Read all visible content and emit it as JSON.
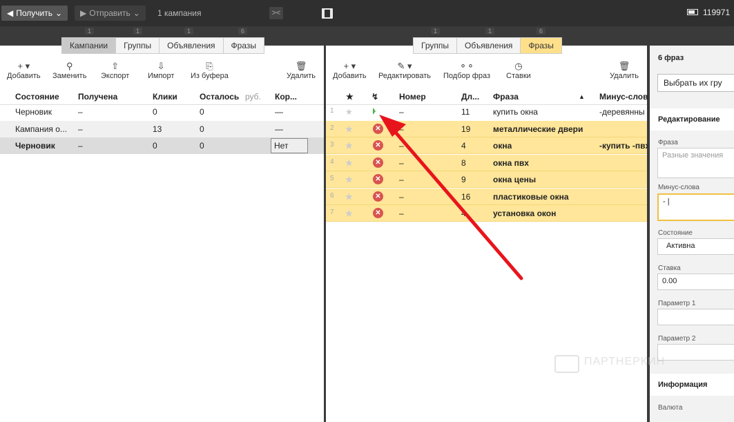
{
  "topbar": {
    "get_label": "Получить",
    "send_label": "Отправить",
    "campaigns_count": "1 кампания",
    "user_id": "119971"
  },
  "badges": [
    "1",
    "1",
    "1",
    "6",
    "1",
    "1",
    "6"
  ],
  "left": {
    "tabs": [
      "Кампании",
      "Группы",
      "Объявления",
      "Фразы"
    ],
    "active_tab": 0,
    "toolbar": [
      "Добавить",
      "Заменить",
      "Экспорт",
      "Импорт",
      "Из буфера",
      "Удалить"
    ],
    "columns": [
      "Состояние",
      "Получена",
      "Клики",
      "Осталось",
      "руб.",
      "Кор..."
    ],
    "rows": [
      {
        "state": "Черновик",
        "received": "–",
        "clicks": "0",
        "left": "0",
        "kor": "—"
      },
      {
        "state": "Кампания о...",
        "received": "–",
        "clicks": "13",
        "left": "0",
        "kor": "—"
      },
      {
        "state": "Черновик",
        "received": "–",
        "clicks": "0",
        "left": "0",
        "kor": "Нет"
      }
    ]
  },
  "mid": {
    "tabs": [
      "Группы",
      "Объявления",
      "Фразы"
    ],
    "active_tab": 2,
    "toolbar": [
      "Добавить",
      "Редактировать",
      "Подбор фраз",
      "Ставки",
      "Удалить"
    ],
    "columns": [
      "★",
      "Номер",
      "Дл...",
      "Фраза",
      "Минус-слов"
    ],
    "rows": [
      {
        "n": "1",
        "num": "–",
        "len": "11",
        "phrase": "купить окна",
        "minus": "-деревянны"
      },
      {
        "n": "2",
        "num": "–",
        "len": "19",
        "phrase": "металлические двери",
        "minus": ""
      },
      {
        "n": "3",
        "num": "–",
        "len": "4",
        "phrase": "окна",
        "minus": "-купить -пвх"
      },
      {
        "n": "4",
        "num": "–",
        "len": "8",
        "phrase": "окна пвх",
        "minus": ""
      },
      {
        "n": "5",
        "num": "–",
        "len": "9",
        "phrase": "окна цены",
        "minus": ""
      },
      {
        "n": "6",
        "num": "–",
        "len": "16",
        "phrase": "пластиковые окна",
        "minus": ""
      },
      {
        "n": "7",
        "num": "–",
        "len": "4",
        "phrase": "установка окон",
        "minus": ""
      }
    ]
  },
  "right": {
    "title": "6 фраз",
    "select_btn": "Выбрать их гру",
    "section_edit": "Редактирование",
    "phrase_label": "Фраза",
    "phrase_placeholder": "Разные значения",
    "minus_label": "Минус-слова",
    "minus_value": "- |",
    "state_label": "Состояние",
    "state_value": "Активна",
    "bid_label": "Ставка",
    "bid_value": "0.00",
    "param1_label": "Параметр 1",
    "param2_label": "Параметр 2",
    "section_info": "Информация",
    "currency_label": "Валюта"
  },
  "watermark": "ПАРТНЕРКИН",
  "colors": {
    "highlight": "#ffe69a",
    "active_tab": "#ffe08a",
    "arrow": "#e8141c"
  }
}
